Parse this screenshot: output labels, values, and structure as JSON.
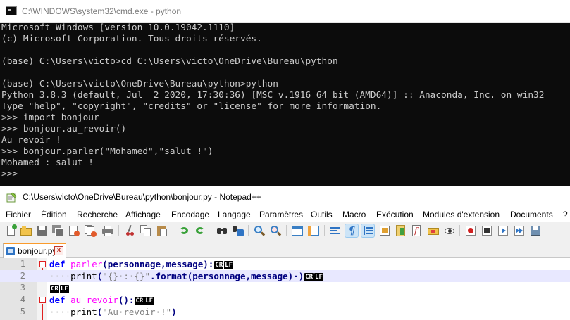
{
  "cmd": {
    "title": "C:\\WINDOWS\\system32\\cmd.exe - python",
    "lines": [
      "Microsoft Windows [version 10.0.19042.1110]",
      "(c) Microsoft Corporation. Tous droits réservés.",
      "",
      "(base) C:\\Users\\victo>cd C:\\Users\\victo\\OneDrive\\Bureau\\python",
      "",
      "(base) C:\\Users\\victo\\OneDrive\\Bureau\\python>python",
      "Python 3.8.3 (default, Jul  2 2020, 17:30:36) [MSC v.1916 64 bit (AMD64)] :: Anaconda, Inc. on win32",
      "Type \"help\", \"copyright\", \"credits\" or \"license\" for more information.",
      ">>> import bonjour",
      ">>> bonjour.au_revoir()",
      "Au revoir !",
      ">>> bonjour.parler(\"Mohamed\",\"salut !\")",
      "Mohamed : salut !",
      ">>> "
    ]
  },
  "npp": {
    "title": "C:\\Users\\victo\\OneDrive\\Bureau\\python\\bonjour.py - Notepad++",
    "menu": [
      "Fichier",
      "Édition",
      "Recherche",
      "Affichage",
      "Encodage",
      "Langage",
      "Paramètres",
      "Outils",
      "Macro",
      "Exécution",
      "Modules d'extension",
      "Documents",
      "?"
    ],
    "toolbar_icons": [
      "new-file-icon",
      "open-file-icon",
      "save-icon",
      "save-all-icon",
      "close-icon",
      "close-all-icon",
      "print-icon",
      "cut-icon",
      "copy-icon",
      "paste-icon",
      "undo-icon",
      "redo-icon",
      "find-icon",
      "replace-icon",
      "zoom-in-icon",
      "zoom-out-icon",
      "sync-vertical-icon",
      "sync-horizontal-icon",
      "word-wrap-icon",
      "show-all-characters-icon",
      "indent-guide-icon",
      "user-defined-language-icon",
      "document-map-icon",
      "function-list-icon",
      "folder-as-workspace-icon",
      "monitoring-icon",
      "record-macro-icon",
      "stop-recording-icon",
      "playback-macro-icon",
      "run-macro-multiple-icon",
      "save-macro-icon"
    ],
    "tab": {
      "label": "bonjour.py",
      "close": "X"
    },
    "eol": {
      "cr": "CR",
      "lf": "LF"
    },
    "editor": {
      "line_numbers": [
        "1",
        "2",
        "3",
        "4",
        "5"
      ],
      "line1": {
        "kw": "def",
        "name": "parler",
        "params": "(personnage,message):"
      },
      "line2": {
        "print": "print",
        "lp": "(",
        "fmt": "\"{}·:·{}\"",
        "rest": ".format(personnage,message)·)"
      },
      "line4": {
        "kw": "def",
        "name": "au_revoir",
        "params": "():"
      },
      "line5": {
        "print": "print",
        "lp": "(",
        "str": "\"Au·revoir·!\"",
        "rp": ")"
      }
    }
  },
  "colors": {
    "keyword": "#0000ff",
    "function_name": "#ff00ff",
    "operator": "#000080",
    "string": "#808080",
    "current_line": "#e8e8ff",
    "tab_accent": "#fa9b2c"
  }
}
